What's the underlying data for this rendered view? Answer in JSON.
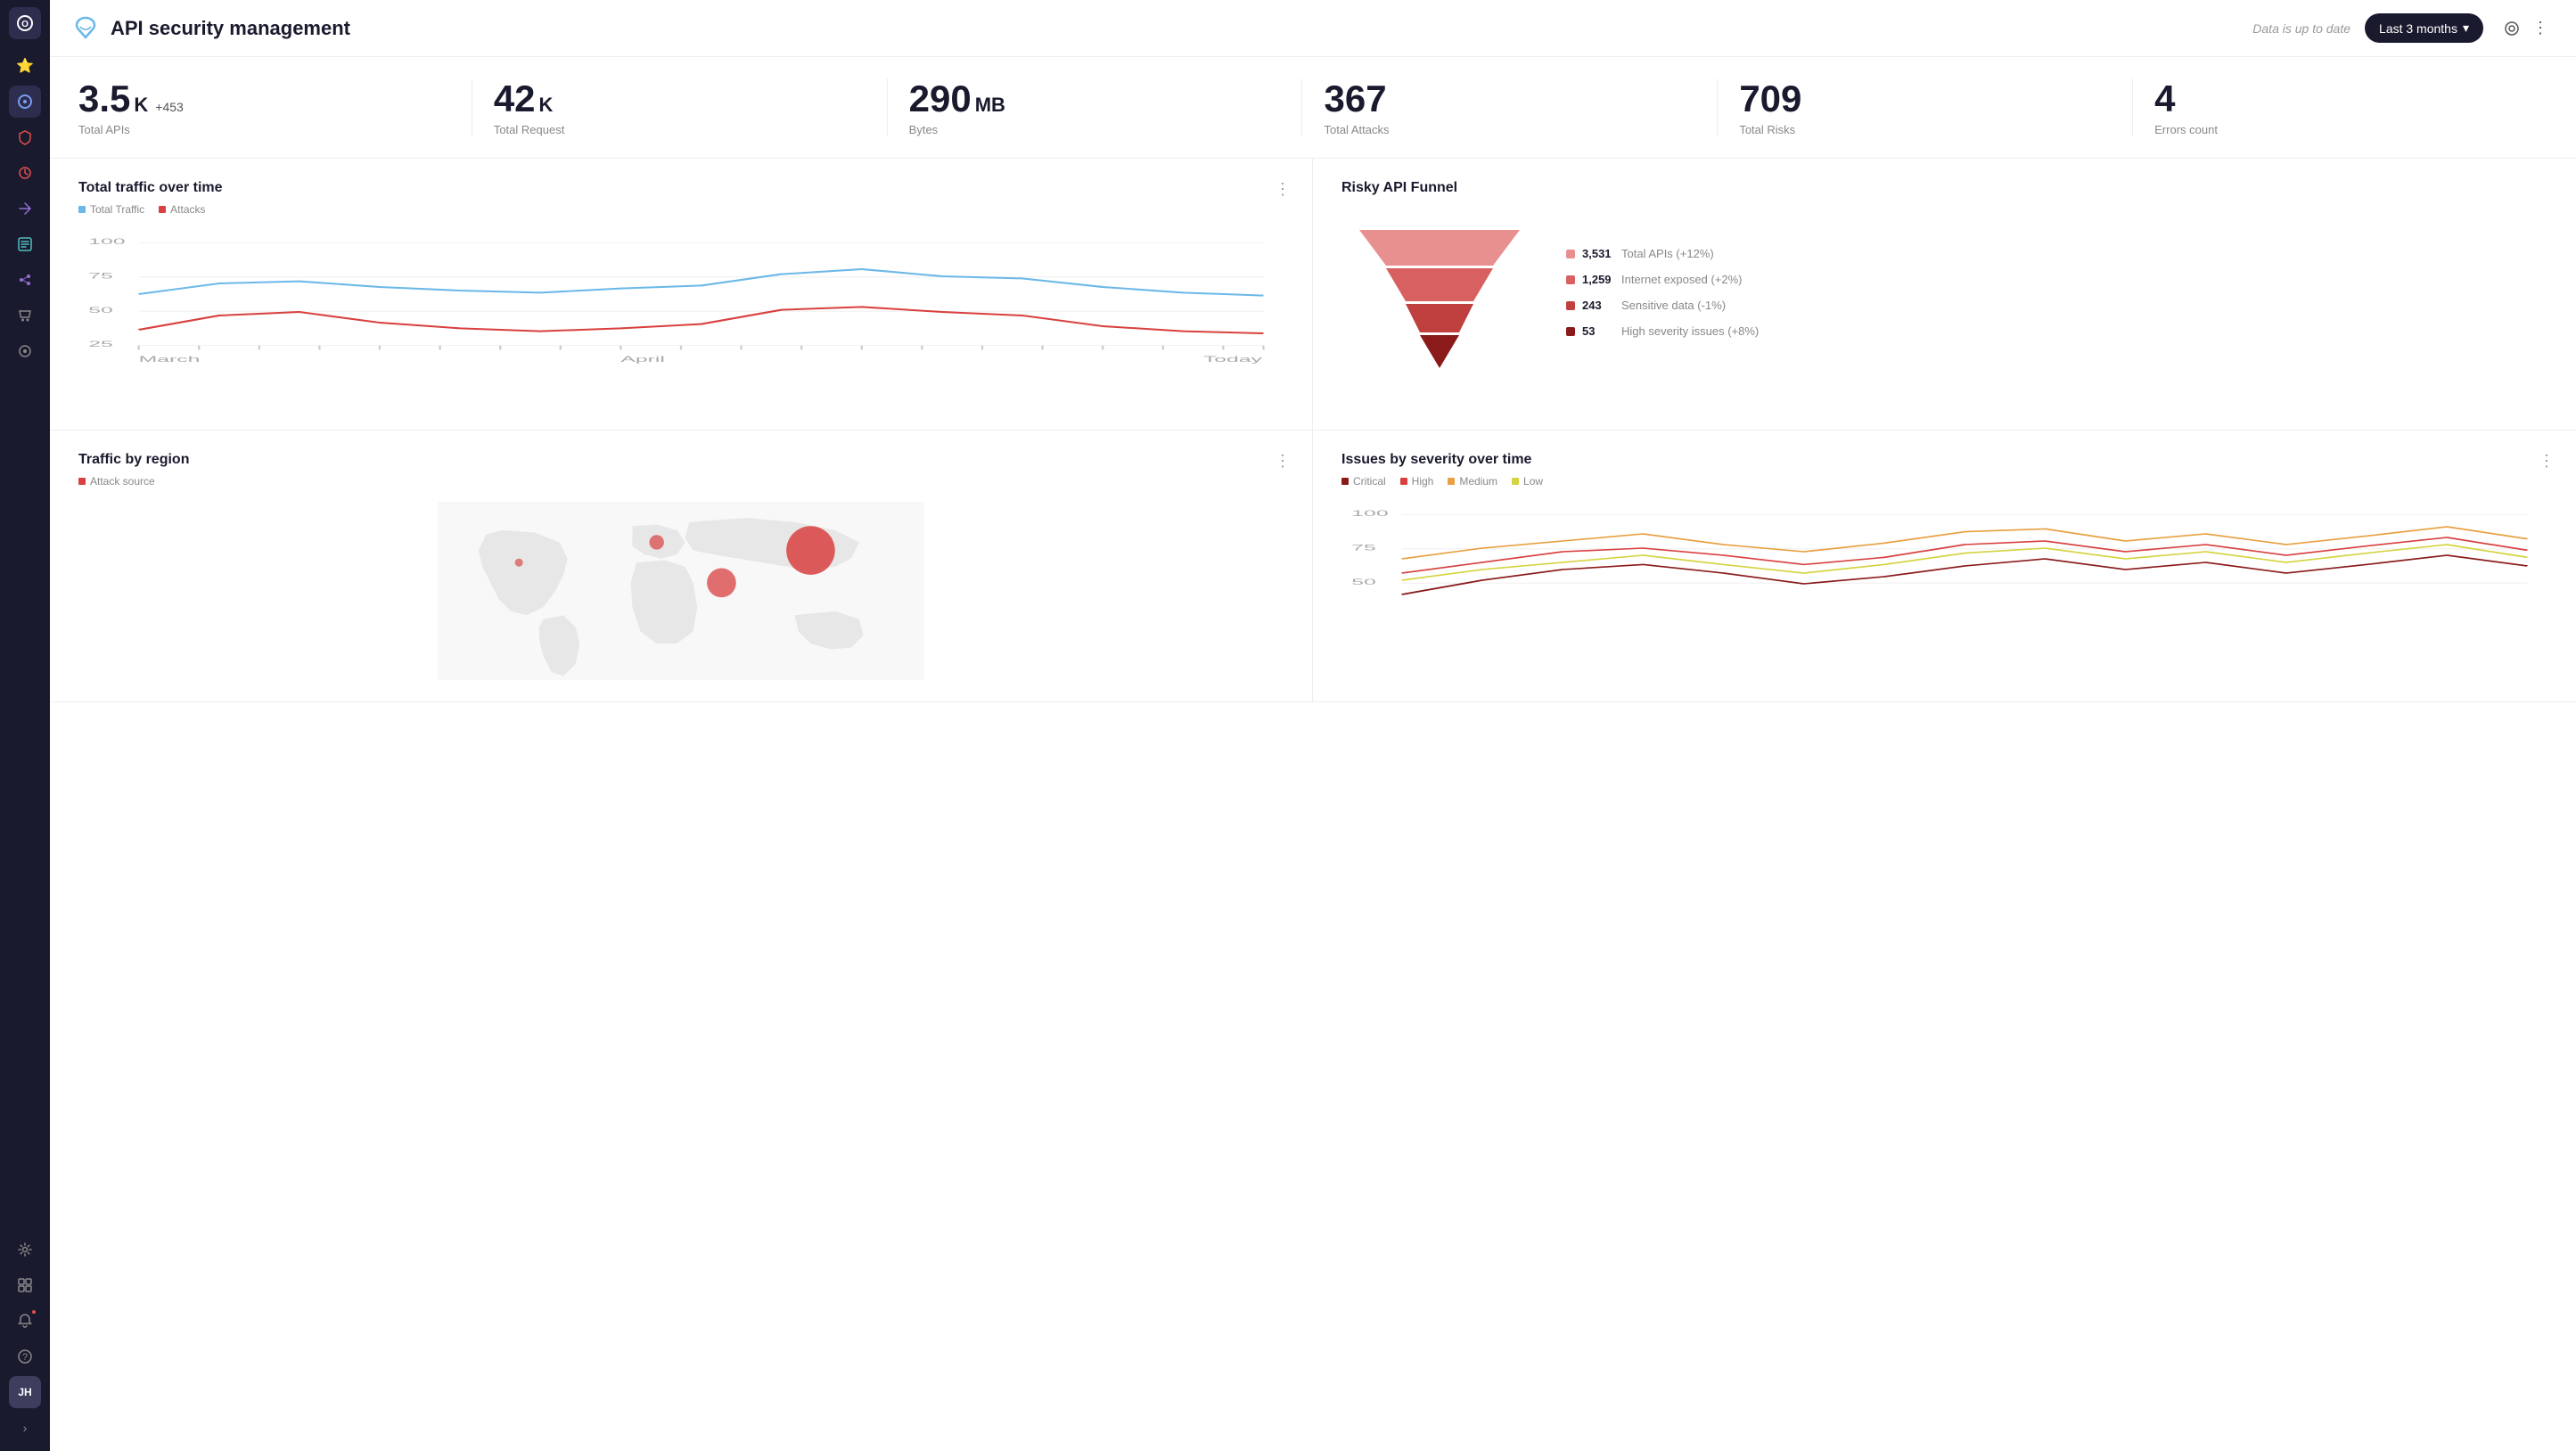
{
  "app": {
    "title": "API security management"
  },
  "header": {
    "status": "Data is up to date",
    "time_range": "Last 3 months",
    "logo_alt": "API Security Logo"
  },
  "kpis": [
    {
      "value": "3.5",
      "unit": "K",
      "badge": "+453",
      "label": "Total APIs"
    },
    {
      "value": "42",
      "unit": "K",
      "badge": "",
      "label": "Total Request"
    },
    {
      "value": "290",
      "unit": "MB",
      "badge": "",
      "label": "Bytes"
    },
    {
      "value": "367",
      "unit": "",
      "badge": "",
      "label": "Total Attacks"
    },
    {
      "value": "709",
      "unit": "",
      "badge": "",
      "label": "Total Risks"
    },
    {
      "value": "4",
      "unit": "",
      "badge": "",
      "label": "Errors count"
    }
  ],
  "charts": {
    "traffic": {
      "title": "Total traffic over time",
      "legend": [
        {
          "label": "Total Traffic",
          "color": "#6bb8e8"
        },
        {
          "label": "Attacks",
          "color": "#d94040"
        }
      ],
      "x_labels": [
        "March",
        "April",
        "Today"
      ]
    },
    "funnel": {
      "title": "Risky API Funnel",
      "items": [
        {
          "value": "3,531",
          "label": "Total APIs (+12%)",
          "color": "#e89090"
        },
        {
          "value": "1,259",
          "label": "Internet exposed (+2%)",
          "color": "#d96060"
        },
        {
          "value": "243",
          "label": "Sensitive data (-1%)",
          "color": "#c04040"
        },
        {
          "value": "53",
          "label": "High severity issues (+8%)",
          "color": "#8b1a1a"
        }
      ]
    },
    "region": {
      "title": "Traffic by region",
      "legend": [
        {
          "label": "Attack source",
          "color": "#d94040"
        }
      ]
    },
    "severity": {
      "title": "Issues by severity over time",
      "legend": [
        {
          "label": "Critical",
          "color": "#8b1a1a"
        },
        {
          "label": "High",
          "color": "#d94040"
        },
        {
          "label": "Medium",
          "color": "#e8a040"
        },
        {
          "label": "Low",
          "color": "#e8e040"
        }
      ],
      "y_labels": [
        "100",
        "75",
        "50"
      ]
    }
  },
  "sidebar": {
    "items": [
      {
        "icon": "⭐",
        "name": "favorites",
        "active": false
      },
      {
        "icon": "◎",
        "name": "dashboard",
        "active": true
      },
      {
        "icon": "🛡",
        "name": "security",
        "active": false
      },
      {
        "icon": "👁",
        "name": "monitoring",
        "active": false
      },
      {
        "icon": "⟳",
        "name": "integrations",
        "active": false
      },
      {
        "icon": "▭",
        "name": "inventory",
        "active": false
      },
      {
        "icon": "⋯",
        "name": "graph",
        "active": false
      },
      {
        "icon": "🛒",
        "name": "marketplace",
        "active": false
      },
      {
        "icon": "◉",
        "name": "center",
        "active": false
      },
      {
        "icon": "⚙",
        "name": "settings",
        "active": false
      },
      {
        "icon": "⊞",
        "name": "grid",
        "active": false
      },
      {
        "icon": "🔔",
        "name": "notifications",
        "active": false
      },
      {
        "icon": "?",
        "name": "help",
        "active": false
      }
    ],
    "avatar": "JH",
    "expand_icon": "›"
  }
}
